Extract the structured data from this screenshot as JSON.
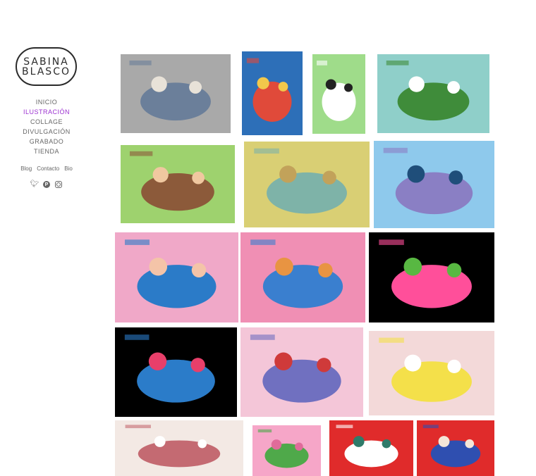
{
  "logo": {
    "line1": "SABINA",
    "line2": "BLASCO"
  },
  "nav": {
    "items": [
      {
        "label": "INICIO",
        "active": false
      },
      {
        "label": "ILUSTRACIÓN",
        "active": true
      },
      {
        "label": "COLLAGE",
        "active": false
      },
      {
        "label": "DIVULGACIÓN",
        "active": false
      },
      {
        "label": "GRABADO",
        "active": false
      },
      {
        "label": "TIENDA",
        "active": false
      }
    ],
    "active_color": "#9b30d0"
  },
  "subnav": {
    "blog": "Blog",
    "contacto": "Contacto",
    "bio": "Bio"
  },
  "social": [
    "twitter-icon",
    "pinterest-icon",
    "instagram-icon"
  ],
  "gallery": [
    {
      "name": "illustration-stairs-musicians",
      "palette": [
        "#a9a9a9",
        "#6b7f9a",
        "#e8e2d8"
      ]
    },
    {
      "name": "illustration-kids-reading",
      "palette": [
        "#2d6fb8",
        "#e04a3a",
        "#f2c84b"
      ]
    },
    {
      "name": "illustration-bride-green",
      "palette": [
        "#9fdc8a",
        "#ffffff",
        "#222222"
      ]
    },
    {
      "name": "illustration-swan-pond",
      "palette": [
        "#8fcfc9",
        "#3f8c3a",
        "#ffffff"
      ]
    },
    {
      "name": "illustration-couple-portraits",
      "palette": [
        "#9ed26e",
        "#8c5a3a",
        "#f0c8a0"
      ]
    },
    {
      "name": "illustration-bathers-forest",
      "palette": [
        "#d9cf74",
        "#7eb3a8",
        "#c2a25a"
      ]
    },
    {
      "name": "illustration-armadillo",
      "palette": [
        "#8ec9ec",
        "#8a7fc4",
        "#1f4e7a"
      ]
    },
    {
      "name": "illustration-mountain-bath",
      "palette": [
        "#f0a8c8",
        "#2b7bc8",
        "#f4c4a8"
      ]
    },
    {
      "name": "illustration-sleeping-fox",
      "palette": [
        "#f08fb4",
        "#3a7fcf",
        "#e89442"
      ]
    },
    {
      "name": "illustration-birds-flower",
      "palette": [
        "#000000",
        "#ff4f9a",
        "#58b842"
      ]
    },
    {
      "name": "illustration-swallow-roses",
      "palette": [
        "#000000",
        "#2b7cc9",
        "#e83f6a"
      ]
    },
    {
      "name": "illustration-owl-snow",
      "palette": [
        "#f4c6d8",
        "#7070c0",
        "#cf3a3a"
      ]
    },
    {
      "name": "illustration-fruit-tray",
      "palette": [
        "#f3d9d9",
        "#f4e04a",
        "#ffffff"
      ]
    },
    {
      "name": "illustration-moon-woman",
      "palette": [
        "#f3e9e4",
        "#c46a72",
        "#ffffff"
      ]
    },
    {
      "name": "illustration-flower-vase",
      "palette": [
        "#f6a6c8",
        "#4fa94a",
        "#e06b9a"
      ]
    },
    {
      "name": "illustration-crowned-girl",
      "palette": [
        "#e02b2b",
        "#ffffff",
        "#2f7b6a"
      ]
    },
    {
      "name": "illustration-third-eye",
      "palette": [
        "#e02b2b",
        "#2f4fb0",
        "#f4e6d8"
      ]
    }
  ]
}
